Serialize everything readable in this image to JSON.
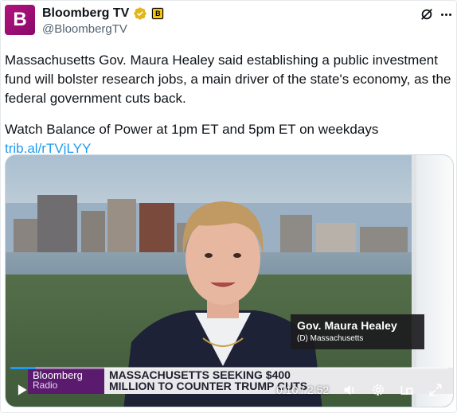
{
  "account": {
    "display_name": "Bloomberg TV",
    "handle": "@BloombergTV",
    "avatar_letter": "B",
    "affiliate_letter": "B"
  },
  "tweet": {
    "paragraph1": "Massachusetts Gov. Maura Healey said establishing a public investment fund will bolster research jobs, a main driver of the state's economy, as the federal government cuts back.",
    "paragraph2_prefix": "Watch Balance of Power at 1pm ET and 5pm ET on weekdays ",
    "link": "trib.al/rTVjLYY"
  },
  "video": {
    "lower_third_name": "Gov. Maura Healey",
    "lower_third_sub": "(D) Massachusetts",
    "ticker_brand_line1": "Bloomberg",
    "ticker_brand_line2": "Radio",
    "ticker_line1": "MASSACHUSETTS SEEKING $400",
    "ticker_line2": "MILLION TO COUNTER TRUMP CUTS",
    "time_display": "0:10 / 2:52",
    "progress": 0.058
  },
  "colors": {
    "brand": "#b1127d",
    "link": "#1d9bf0",
    "verified": "#e2b719"
  },
  "icons": [
    "verified-badge-icon",
    "affiliate-badge-icon",
    "grok-icon",
    "more-icon",
    "play-icon",
    "volume-icon",
    "settings-icon",
    "pip-icon",
    "fullscreen-icon"
  ]
}
